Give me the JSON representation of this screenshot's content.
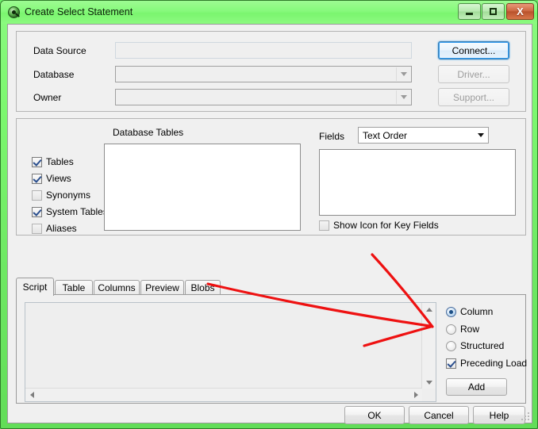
{
  "window": {
    "title": "Create Select Statement",
    "icon": "qlikview-circle-icon",
    "frame_color": "#7cf76f",
    "controls": {
      "minimize": "minimize-icon",
      "maximize": "maximize-icon",
      "close": "X"
    }
  },
  "connection": {
    "data_source_label": "Data Source",
    "data_source_value": "",
    "database_label": "Database",
    "database_value": "",
    "owner_label": "Owner",
    "owner_value": "",
    "connect_button": "Connect...",
    "driver_button": "Driver...",
    "support_button": "Support..."
  },
  "objects": {
    "database_tables_label": "Database Tables",
    "filters": [
      {
        "label": "Tables",
        "checked": true
      },
      {
        "label": "Views",
        "checked": true
      },
      {
        "label": "Synonyms",
        "checked": false
      },
      {
        "label": "System Tables",
        "checked": true
      },
      {
        "label": "Aliases",
        "checked": false
      }
    ],
    "tables_list_items": [],
    "fields_label": "Fields",
    "fields_order_value": "Text Order",
    "fields_order_options": [
      "Text Order"
    ],
    "fields_list_items": [],
    "show_icon_key_fields": {
      "label": "Show Icon for Key Fields",
      "checked": false
    }
  },
  "tabs": {
    "items": [
      "Script",
      "Table",
      "Columns",
      "Preview",
      "Blobs"
    ],
    "active": "Script"
  },
  "script": {
    "text": "",
    "scroll_up": "scroll-up-icon",
    "scroll_down": "scroll-down-icon",
    "scroll_left": "scroll-left-icon",
    "scroll_right": "scroll-right-icon"
  },
  "generation": {
    "modes": [
      {
        "label": "Column",
        "selected": true
      },
      {
        "label": "Row",
        "selected": false
      },
      {
        "label": "Structured",
        "selected": false
      }
    ],
    "preceding_load": {
      "label": "Preceding Load",
      "checked": true
    },
    "add_button": "Add"
  },
  "footer": {
    "ok_button": "OK",
    "cancel_button": "Cancel",
    "help_button": "Help"
  },
  "annotation": {
    "color": "#ee1111",
    "description": "hand-drawn red arrow pointing at Preceding Load checkbox"
  }
}
